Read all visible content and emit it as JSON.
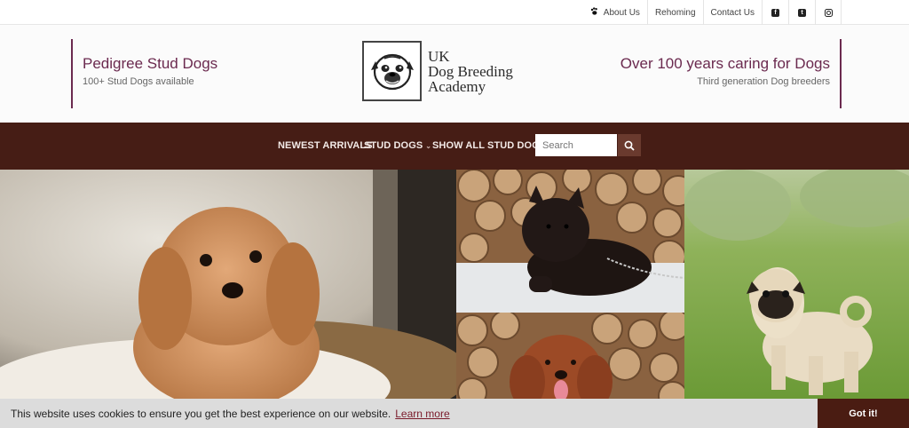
{
  "topbar": {
    "links": [
      {
        "label": "About Us",
        "icon": "paw-icon"
      },
      {
        "label": "Rehoming"
      },
      {
        "label": "Contact Us"
      }
    ],
    "social": [
      "facebook-icon",
      "twitter-icon",
      "instagram-icon"
    ]
  },
  "header": {
    "left_title": "Pedigree Stud Dogs",
    "left_subtitle": "100+ Stud Dogs available",
    "logo_line1": "UK",
    "logo_line2": "Dog Breeding",
    "logo_line3": "Academy",
    "right_title": "Over 100 years caring for Dogs",
    "right_subtitle": "Third generation Dog breeders"
  },
  "nav": {
    "items": [
      "NEWEST ARRIVALS",
      "STUD DOGS",
      "SHOW ALL STUD DOGS"
    ],
    "search_placeholder": "Search"
  },
  "hero": {
    "images": [
      "toy-poodle-puppy-photo",
      "black-pomeranian-photo",
      "red-cockapoo-photo",
      "pug-in-grass-photo"
    ]
  },
  "cookie": {
    "message": "This website uses cookies to ensure you get the best experience on our website.",
    "learn_more": "Learn more",
    "button": "Got it!"
  },
  "colors": {
    "accent": "#6b2a4f",
    "nav_bg": "#461d15",
    "cookie_button": "#4a1c12"
  }
}
